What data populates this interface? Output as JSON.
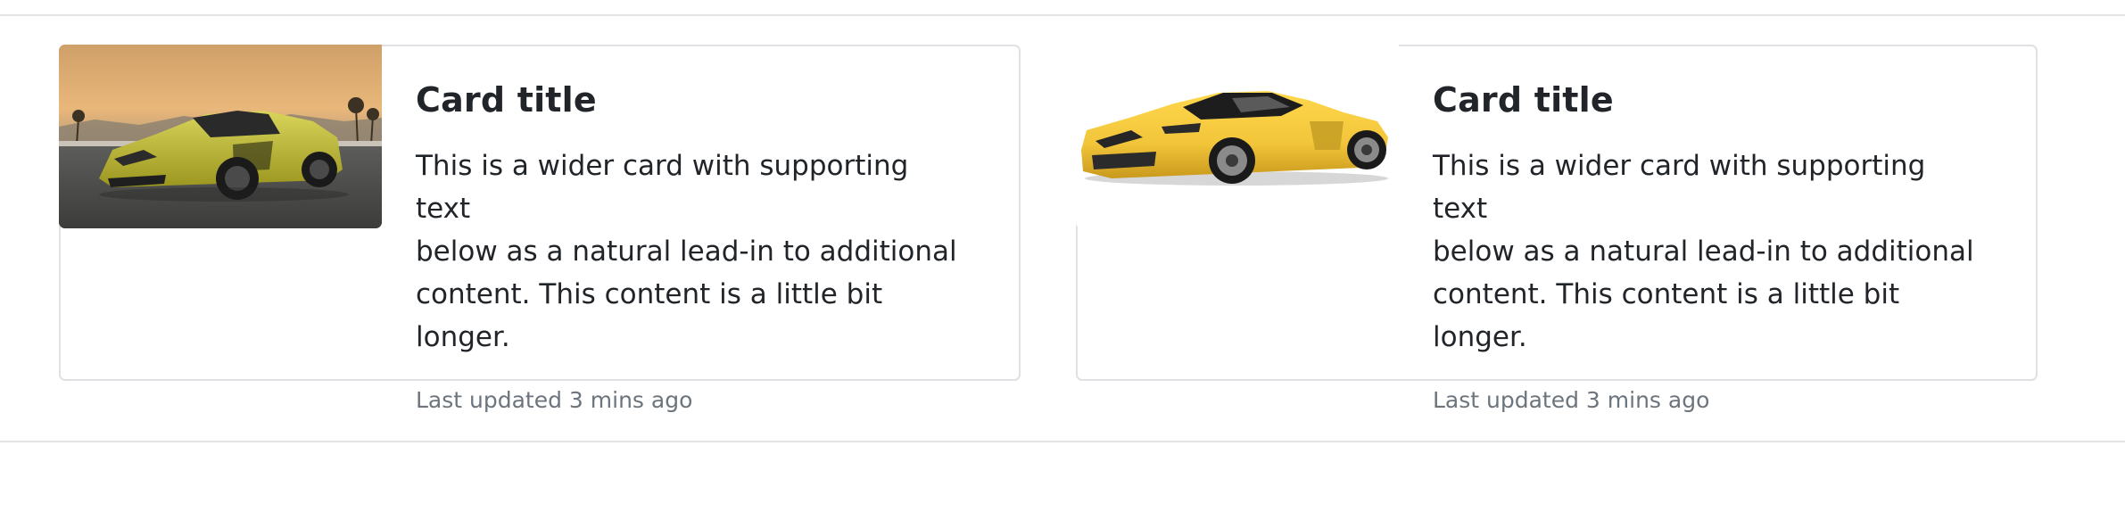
{
  "cards": [
    {
      "title": "Card title",
      "text": "This is a wider card with supporting text\nbelow as a natural lead-in to additional\ncontent. This content is a little bit longer.",
      "updated": "Last updated 3 mins ago",
      "image": "yellow-hypercar-photo"
    },
    {
      "title": "Card title",
      "text": "This is a wider card with supporting text\nbelow as a natural lead-in to additional\ncontent. This content is a little bit longer.",
      "updated": "Last updated 3 mins ago",
      "image": "yellow-lamborghini-illustration"
    }
  ],
  "colors": {
    "text": "#212529",
    "muted": "#6c757d",
    "border": "#dfe1e4",
    "car_yellow": "#f2c53a"
  }
}
